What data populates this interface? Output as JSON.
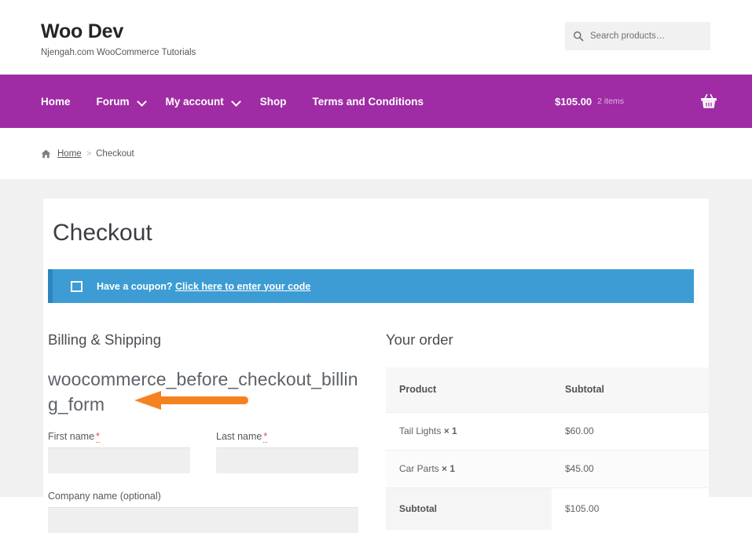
{
  "header": {
    "site_title": "Woo Dev",
    "tagline": "Njengah.com WooCommerce Tutorials",
    "search": {
      "placeholder": "Search products…",
      "icon": "search-icon"
    }
  },
  "nav": {
    "items": [
      {
        "label": "Home",
        "has_dropdown": false
      },
      {
        "label": "Forum",
        "has_dropdown": true
      },
      {
        "label": "My account",
        "has_dropdown": true
      },
      {
        "label": "Shop",
        "has_dropdown": false
      },
      {
        "label": "Terms and Conditions",
        "has_dropdown": false
      }
    ],
    "cart": {
      "amount": "$105.00",
      "count": "2 items",
      "icon": "shopping-basket-icon"
    },
    "background_color": "#9f2ca4"
  },
  "breadcrumb": {
    "home_icon": "home-icon",
    "home_label": "Home",
    "separator": ">",
    "current": "Checkout"
  },
  "page": {
    "title": "Checkout"
  },
  "coupon": {
    "icon": "coupon-tag-icon",
    "text": "Have a coupon? ",
    "link_label": "Click here to enter your code",
    "background_color": "#3d9cd4",
    "border_color": "#2d85bd"
  },
  "billing": {
    "heading": "Billing & Shipping",
    "hook_name": "woocommerce_before_checkout_billing_form",
    "annotation": {
      "type": "arrow-left",
      "color": "#F58220"
    },
    "fields": [
      {
        "label": "First name",
        "required": true,
        "required_mark": "*",
        "value": ""
      },
      {
        "label": "Last name",
        "required": true,
        "required_mark": "*",
        "value": ""
      },
      {
        "label": "Company name (optional)",
        "required": false,
        "required_mark": "",
        "value": ""
      }
    ]
  },
  "order": {
    "heading": "Your order",
    "columns": [
      "Product",
      "Subtotal"
    ],
    "rows": [
      {
        "product": "Tail Lights",
        "quantity": "× 1",
        "subtotal": "$60.00"
      },
      {
        "product": "Car Parts",
        "quantity": "× 1",
        "subtotal": "$45.00"
      }
    ],
    "subtotal_label": "Subtotal",
    "subtotal_value": "$105.00"
  }
}
